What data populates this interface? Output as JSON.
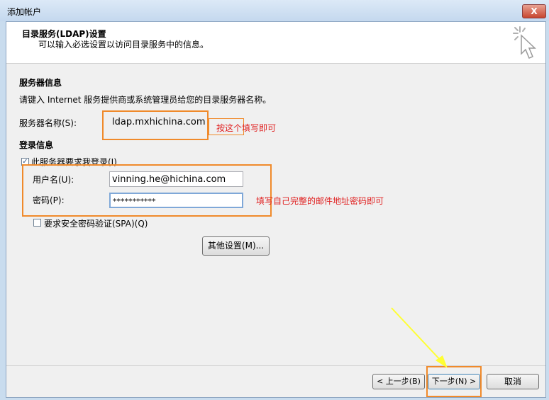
{
  "window": {
    "title": "添加帐户",
    "close_label": "X"
  },
  "header": {
    "title": "目录服务(LDAP)设置",
    "subtitle": "可以输入必选设置以访问目录服务中的信息。"
  },
  "server_info": {
    "section": "服务器信息",
    "description": "请键入 Internet 服务提供商或系统管理员给您的目录服务器名称。",
    "server_label": "服务器名称(S):",
    "server_value": "ldap.mxhichina.com"
  },
  "login_info": {
    "section": "登录信息",
    "requires_login_label": "此服务器要求我登录(I)",
    "requires_login_checked": true,
    "username_label": "用户名(U):",
    "username_value": "vinning.he@hichina.com",
    "password_label": "密码(P):",
    "password_value": "***********",
    "spa_label": "要求安全密码验证(SPA)(Q)",
    "spa_checked": false,
    "more_settings_label": "其他设置(M)..."
  },
  "annotations": {
    "server_note": "按这个填写即可",
    "password_note": "填写自己完整的邮件地址密码即可"
  },
  "footer": {
    "back_label": "< 上一步(B)",
    "next_label": "下一步(N) >",
    "cancel_label": "取消"
  },
  "colors": {
    "highlight_box": "#f08a2b",
    "annotation_text": "#e02020",
    "arrow": "#ffff33"
  }
}
